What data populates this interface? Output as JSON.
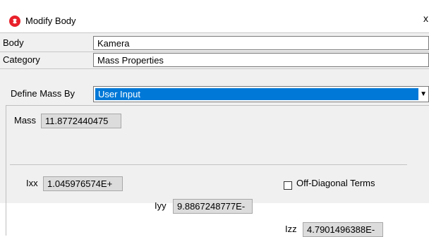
{
  "window": {
    "title": "Modify Body",
    "app_icon": "app-logo-icon",
    "close_glyph": "x",
    "accent_color": "#0078d7"
  },
  "fields": {
    "body_label": "Body",
    "body_value": "Kamera",
    "category_label": "Category",
    "category_value": "Mass Properties",
    "define_mass_label": "Define Mass By",
    "define_mass_value": "User Input"
  },
  "mass": {
    "mass_label": "Mass",
    "mass_value": "11.8772440475",
    "ixx_label": "Ixx",
    "ixx_value": "1.045976574E+",
    "iyy_label": "Iyy",
    "iyy_value": "9.8867248777E-",
    "izz_label": "Izz",
    "izz_value": "4.7901496388E-",
    "off_diagonal_label": "Off-Diagonal Terms",
    "off_diagonal_checked": false
  }
}
